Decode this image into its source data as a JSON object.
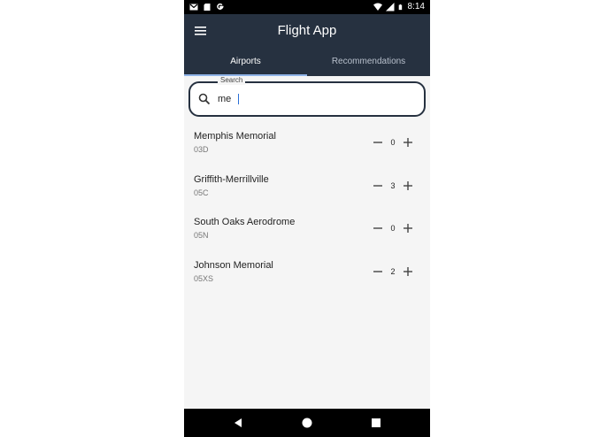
{
  "status_bar": {
    "time": "8:14",
    "left_icons": [
      "gmail-icon",
      "sd-card-icon",
      "google-icon"
    ],
    "right_icons": [
      "wifi-icon",
      "signal-icon",
      "battery-icon"
    ]
  },
  "app_bar": {
    "title": "Flight App",
    "menu_icon": "menu-icon"
  },
  "tabs": [
    {
      "label": "Airports",
      "active": true
    },
    {
      "label": "Recommendations",
      "active": false
    }
  ],
  "search": {
    "label": "Search",
    "value": "me"
  },
  "airports": [
    {
      "name": "Memphis Memorial",
      "code": "03D",
      "count": "0"
    },
    {
      "name": "Griffith-Merrillville",
      "code": "05C",
      "count": "3"
    },
    {
      "name": "South Oaks Aerodrome",
      "code": "05N",
      "count": "0"
    },
    {
      "name": "Johnson Memorial",
      "code": "05XS",
      "count": "2"
    }
  ],
  "nav_bar": [
    "back-icon",
    "home-icon",
    "recents-icon"
  ],
  "colors": {
    "app_bar": "#263140",
    "tab_indicator": "#90b4e8",
    "background": "#f5f5f5"
  }
}
